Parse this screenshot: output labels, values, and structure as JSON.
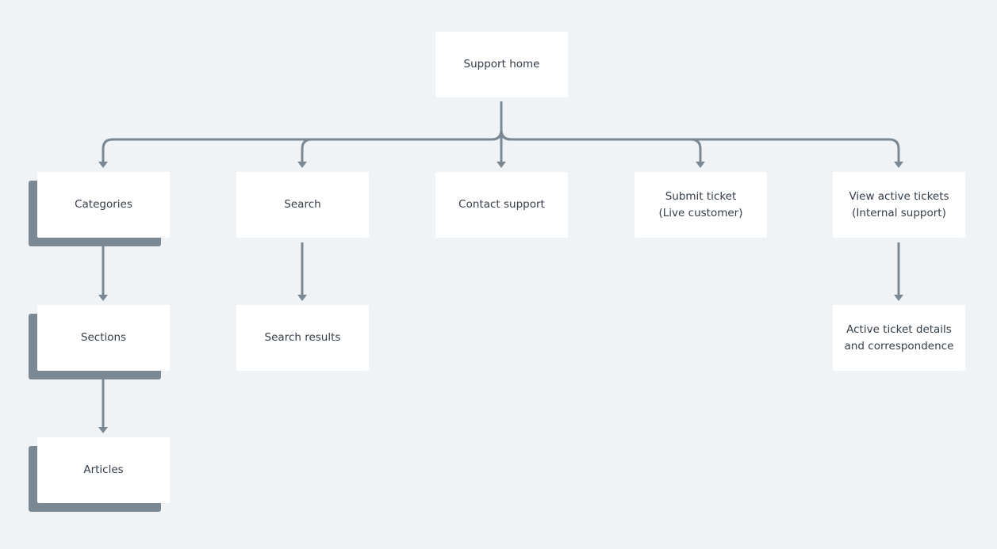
{
  "colors": {
    "background": "#eff3f6",
    "connector": "#7a8894",
    "box": "#ffffff",
    "text": "#333d47",
    "stack_shadow": "#7a8894"
  },
  "nodes": [
    {
      "id": "home",
      "label": "Support home",
      "stacked": false
    },
    {
      "id": "categories",
      "label": "Categories",
      "stacked": true
    },
    {
      "id": "search",
      "label": "Search",
      "stacked": false
    },
    {
      "id": "contact",
      "label": "Contact support",
      "stacked": false
    },
    {
      "id": "submit",
      "label": "Submit ticket\n(Live customer)",
      "stacked": false
    },
    {
      "id": "active",
      "label": "View active tickets\n(Internal support)",
      "stacked": false
    },
    {
      "id": "sections",
      "label": "Sections",
      "stacked": true
    },
    {
      "id": "results",
      "label": "Search results",
      "stacked": false
    },
    {
      "id": "details",
      "label": "Active ticket details\nand correspondence",
      "stacked": false
    },
    {
      "id": "articles",
      "label": "Articles",
      "stacked": true
    }
  ],
  "edges": [
    [
      "home",
      "categories"
    ],
    [
      "home",
      "search"
    ],
    [
      "home",
      "contact"
    ],
    [
      "home",
      "submit"
    ],
    [
      "home",
      "active"
    ],
    [
      "categories",
      "sections"
    ],
    [
      "sections",
      "articles"
    ],
    [
      "search",
      "results"
    ],
    [
      "active",
      "details"
    ]
  ]
}
